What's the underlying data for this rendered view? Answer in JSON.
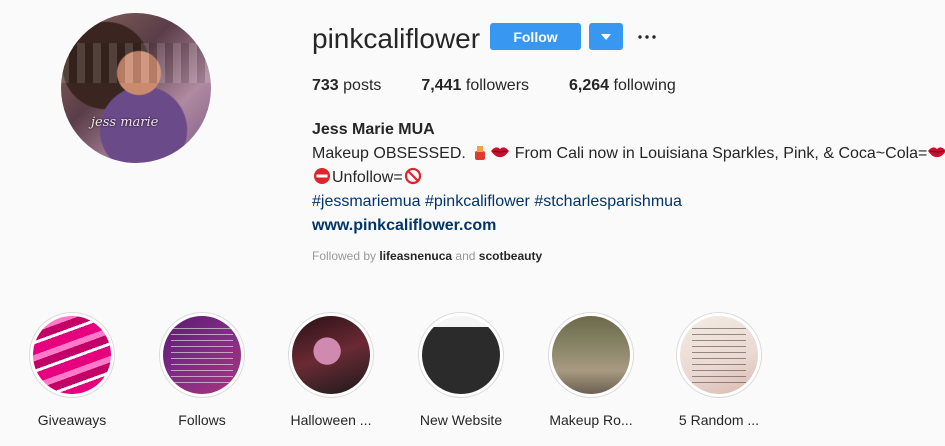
{
  "profile": {
    "username": "pinkcaliflower",
    "avatar_watermark": "jess marie",
    "follow_label": "Follow",
    "dropdown_icon": "caret-down-icon",
    "more_icon": "ellipsis-icon",
    "accent_color": "#3897f0"
  },
  "stats": {
    "posts_count": "733",
    "posts_label": " posts",
    "followers_count": "7,441",
    "followers_label": " followers",
    "following_count": "6,264",
    "following_label": " following"
  },
  "bio": {
    "full_name": "Jess Marie MUA",
    "line1_a": "Makeup OBSESSED. ",
    "line1_b": " From Cali now in Louisiana Sparkles, Pink, & Coca~Cola=",
    "line2": "Unfollow=",
    "hashtags": [
      "#jessmariemua",
      "#pinkcaliflower",
      "#stcharlesparishmua"
    ],
    "website": "www.pinkcaliflower.com"
  },
  "followed_by": {
    "prefix": "Followed by ",
    "user1": "lifeasnenuca",
    "joiner": " and ",
    "user2": "scotbeauty"
  },
  "highlights": [
    {
      "label": "Giveaways"
    },
    {
      "label": "Follows"
    },
    {
      "label": "Halloween ..."
    },
    {
      "label": "New Website"
    },
    {
      "label": "Makeup Ro..."
    },
    {
      "label": "5 Random ..."
    }
  ]
}
